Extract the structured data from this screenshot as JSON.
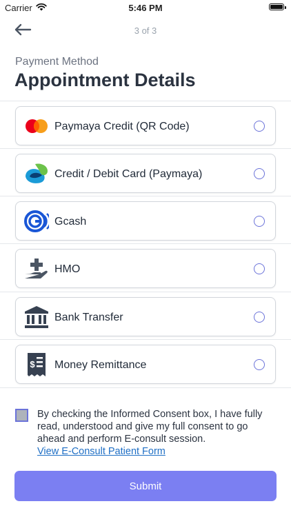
{
  "status_bar": {
    "carrier": "Carrier",
    "time": "5:46 PM"
  },
  "header": {
    "step": "3 of 3"
  },
  "section": {
    "subtitle": "Payment Method",
    "title": "Appointment Details"
  },
  "payment_methods": [
    {
      "label": "Paymaya Credit (QR Code)",
      "icon": "mastercard-icon"
    },
    {
      "label": "Credit / Debit Card (Paymaya)",
      "icon": "paymaya-icon"
    },
    {
      "label": "Gcash",
      "icon": "gcash-icon"
    },
    {
      "label": "HMO",
      "icon": "hmo-hand-cross-icon"
    },
    {
      "label": "Bank Transfer",
      "icon": "bank-icon"
    },
    {
      "label": "Money Remittance",
      "icon": "receipt-dollar-icon"
    }
  ],
  "consent": {
    "text": "By checking the Informed Consent box, I have fully read, understood and give my full consent to go ahead and perform E-consult session.",
    "link": "View E-Consult Patient Form"
  },
  "submit_label": "Submit",
  "colors": {
    "accent": "#7b7ff2",
    "radio": "#6b73d9",
    "link": "#1f6fc5",
    "title": "#2b3340"
  }
}
